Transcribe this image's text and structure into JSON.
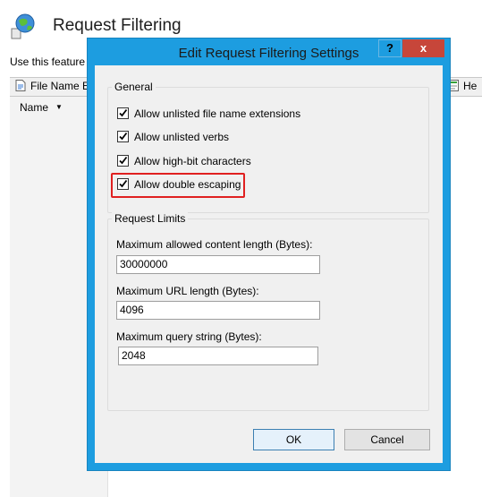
{
  "background": {
    "title": "Request Filtering",
    "description": "Use this feature t",
    "tab_file_name": "File Name E",
    "tab_headers": "He",
    "column_name": "Name"
  },
  "dialog": {
    "title": "Edit Request Filtering Settings",
    "help_label": "?",
    "close_label": "x",
    "general": {
      "label": "General",
      "options": [
        {
          "label": "Allow unlisted file name extensions",
          "checked": true
        },
        {
          "label": "Allow unlisted verbs",
          "checked": true
        },
        {
          "label": "Allow high-bit characters",
          "checked": true
        },
        {
          "label": "Allow double escaping",
          "checked": true
        }
      ]
    },
    "limits": {
      "label": "Request Limits",
      "max_content_length_label": "Maximum allowed content length (Bytes):",
      "max_content_length_value": "30000000",
      "max_url_length_label": "Maximum URL length (Bytes):",
      "max_url_length_value": "4096",
      "max_query_string_label": "Maximum query string (Bytes):",
      "max_query_string_value": "2048"
    },
    "ok_label": "OK",
    "cancel_label": "Cancel"
  },
  "colors": {
    "dialog_frame": "#1d9de0",
    "close_button": "#c7463a",
    "highlight": "#e02020"
  }
}
